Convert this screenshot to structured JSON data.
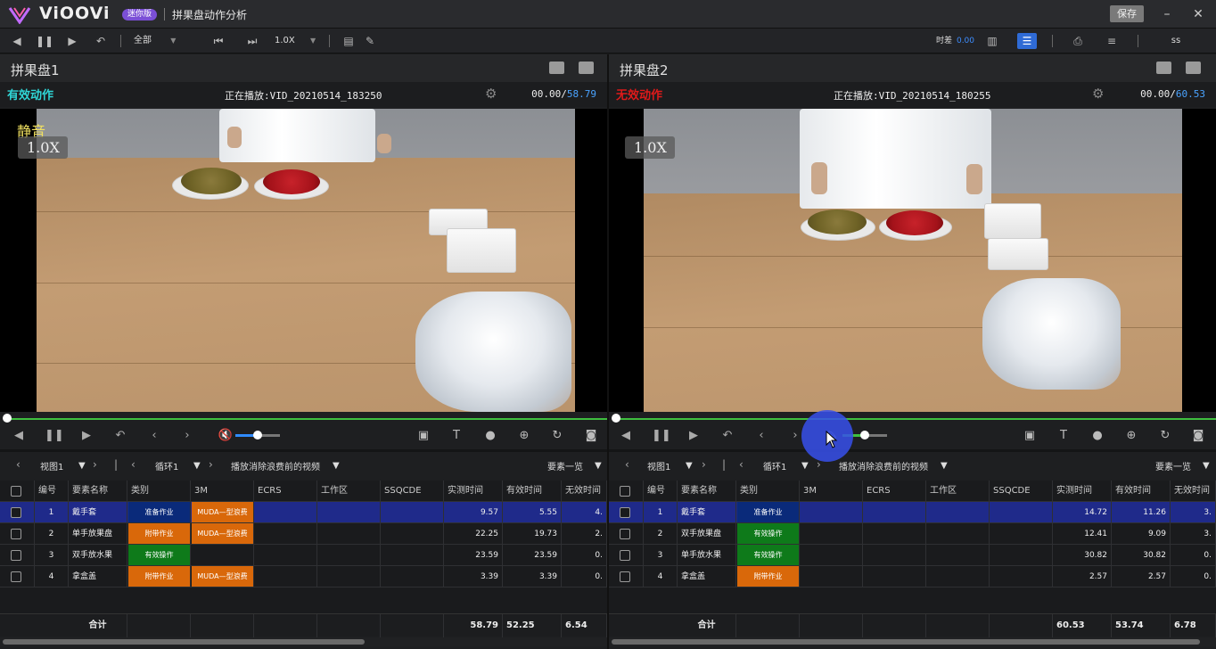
{
  "app": {
    "brand": "ViOOVi",
    "badge": "迷你版",
    "doc_title": "拼果盘动作分析",
    "save_label": "保存"
  },
  "toolbar": {
    "filter_value": "全部",
    "speed_value": "1.0X",
    "diff_label": "时差",
    "diff_value": "0.00",
    "user_value": "ss"
  },
  "panels": [
    {
      "title": "拼果盘1",
      "status_label": "有效动作",
      "status_color": "#2fd6d6",
      "playing": "正在播放:VID_20210514_183250",
      "time_current": "00.00/",
      "time_total": "58.79",
      "overlay_mute": "静音",
      "overlay_speed": "1.0X",
      "tabs": {
        "view": "视图1",
        "loop": "循环1",
        "playback": "播放消除浪费前的视频",
        "elements": "要素一览"
      },
      "columns": [
        "编号",
        "要素名称",
        "类别",
        "3M",
        "ECRS",
        "工作区",
        "SSQCDE",
        "实测时间",
        "有效时间",
        "无效时间"
      ],
      "rows": [
        {
          "no": "1",
          "name": "戴手套",
          "category": "准备作业",
          "category_color": "#0a2a7a",
          "m3": "MUDA—型浪费",
          "m3_color": "#d9680a",
          "measured": "9.57",
          "valid": "5.55",
          "invalid": "4."
        },
        {
          "no": "2",
          "name": "单手放果盘",
          "category": "附带作业",
          "category_color": "#d9680a",
          "m3": "MUDA—型浪费",
          "m3_color": "#d9680a",
          "measured": "22.25",
          "valid": "19.73",
          "invalid": "2."
        },
        {
          "no": "3",
          "name": "双手放水果",
          "category": "有效操作",
          "category_color": "#0e7a1a",
          "m3": "",
          "m3_color": "",
          "measured": "23.59",
          "valid": "23.59",
          "invalid": "0."
        },
        {
          "no": "4",
          "name": "拿盒盖",
          "category": "附带作业",
          "category_color": "#d9680a",
          "m3": "MUDA—型浪费",
          "m3_color": "#d9680a",
          "measured": "3.39",
          "valid": "3.39",
          "invalid": "0."
        }
      ],
      "total": {
        "label": "合计",
        "measured": "58.79",
        "valid": "52.25",
        "invalid": "6.54"
      }
    },
    {
      "title": "拼果盘2",
      "status_label": "无效动作",
      "status_color": "#e01a1a",
      "playing": "正在播放:VID_20210514_180255",
      "time_current": "00.00/",
      "time_total": "60.53",
      "overlay_speed": "1.0X",
      "tabs": {
        "view": "视图1",
        "loop": "循环1",
        "playback": "播放消除浪费前的视频",
        "elements": "要素一览"
      },
      "columns": [
        "编号",
        "要素名称",
        "类别",
        "3M",
        "ECRS",
        "工作区",
        "SSQCDE",
        "实测时间",
        "有效时间",
        "无效时间"
      ],
      "rows": [
        {
          "no": "1",
          "name": "戴手套",
          "category": "准备作业",
          "category_color": "#0a2a7a",
          "m3": "",
          "m3_color": "",
          "measured": "14.72",
          "valid": "11.26",
          "invalid": "3."
        },
        {
          "no": "2",
          "name": "双手放果盘",
          "category": "有效操作",
          "category_color": "#0e7a1a",
          "m3": "",
          "m3_color": "",
          "measured": "12.41",
          "valid": "9.09",
          "invalid": "3."
        },
        {
          "no": "3",
          "name": "单手放水果",
          "category": "有效操作",
          "category_color": "#0e7a1a",
          "m3": "",
          "m3_color": "",
          "measured": "30.82",
          "valid": "30.82",
          "invalid": "0."
        },
        {
          "no": "4",
          "name": "拿盒盖",
          "category": "附带作业",
          "category_color": "#d9680a",
          "m3": "",
          "m3_color": "",
          "measured": "2.57",
          "valid": "2.57",
          "invalid": "0."
        }
      ],
      "total": {
        "label": "合计",
        "measured": "60.53",
        "valid": "53.74",
        "invalid": "6.78"
      }
    }
  ],
  "colors": {
    "selected_row": "#1f2a8a",
    "progress": "#3fbf3f",
    "volume": "#2f8bff"
  }
}
